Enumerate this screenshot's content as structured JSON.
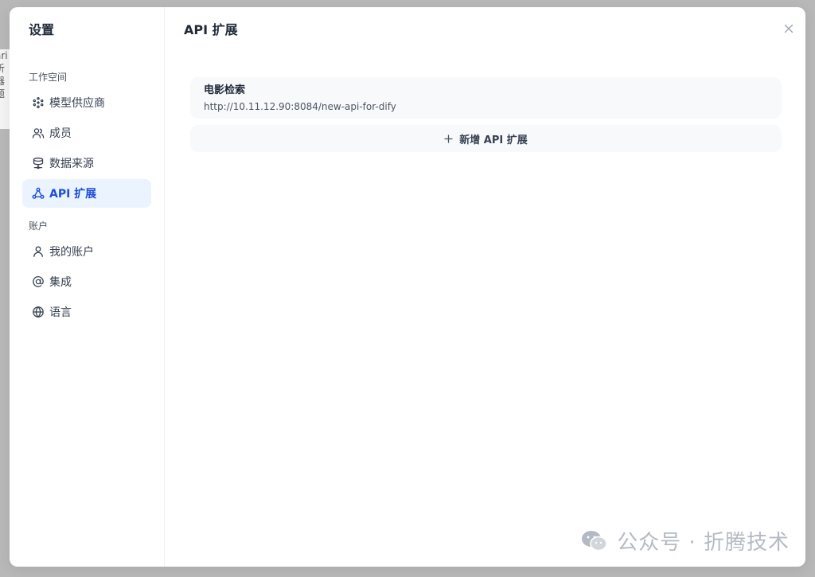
{
  "backdrop": {
    "peek_lines": [
      "ari",
      "析",
      "器",
      "题"
    ]
  },
  "sidebar": {
    "title": "设置",
    "workspace_label": "工作空间",
    "workspace_items": [
      {
        "label": "模型供应商",
        "icon": "model-provider-icon"
      },
      {
        "label": "成员",
        "icon": "members-icon"
      },
      {
        "label": "数据来源",
        "icon": "data-source-icon"
      },
      {
        "label": "API 扩展",
        "icon": "api-extension-icon",
        "active": true
      }
    ],
    "account_label": "账户",
    "account_items": [
      {
        "label": "我的账户",
        "icon": "user-icon"
      },
      {
        "label": "集成",
        "icon": "at-sign-icon"
      },
      {
        "label": "语言",
        "icon": "globe-icon"
      }
    ]
  },
  "main": {
    "title": "API 扩展",
    "extensions": [
      {
        "name": "电影检索",
        "url": "http://10.11.12.90:8084/new-api-for-dify"
      }
    ],
    "add_label": "新增 API 扩展"
  },
  "watermark": {
    "text": "公众号 · 折腾技术"
  },
  "colors": {
    "accent": "#1d4ed8",
    "active_bg": "#ebf3ff",
    "card_bg": "#f8f9fb"
  }
}
